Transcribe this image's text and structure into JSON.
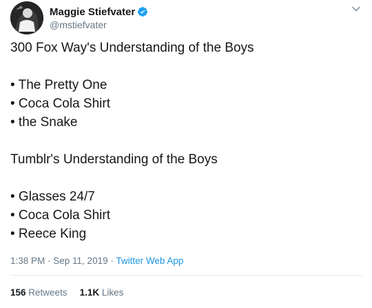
{
  "author": {
    "display_name": "Maggie Stiefvater",
    "handle": "@mstiefvater",
    "verified_icon": "verified-badge-icon",
    "accent_color": "#1da1f2"
  },
  "tweet": {
    "lines": [
      "300 Fox Way's Understanding of the Boys",
      "",
      "• The Pretty One",
      "• Coca Cola Shirt",
      "• the Snake",
      "",
      "Tumblr's Understanding of the Boys",
      "",
      "• Glasses 24/7",
      "• Coca Cola Shirt",
      "• Reece King"
    ],
    "timestamp": "1:38 PM · Sep 11, 2019",
    "separator": " · ",
    "source": "Twitter Web App"
  },
  "stats": {
    "retweets_count": "156",
    "retweets_label": "Retweets",
    "likes_count": "1.1K",
    "likes_label": "Likes"
  }
}
